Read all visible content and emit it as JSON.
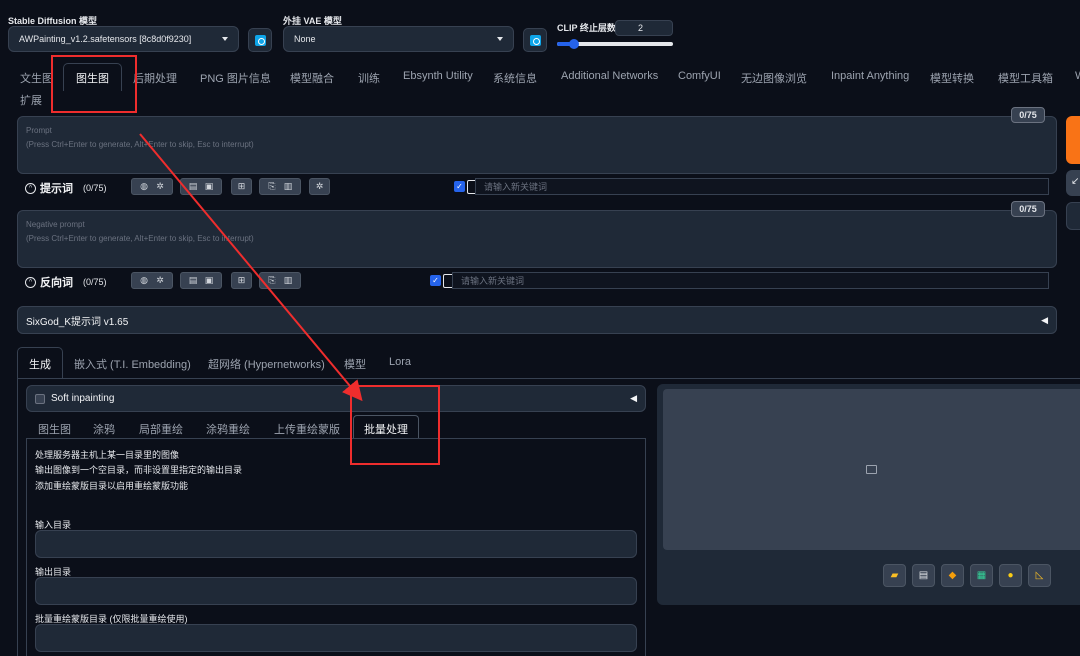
{
  "top": {
    "sd_model_label": "Stable Diffusion 模型",
    "sd_model_value": "AWPainting_v1.2.safetensors [8c8d0f9230]",
    "vae_label": "外挂 VAE 模型",
    "vae_value": "None",
    "clip_label": "CLIP 终止层数",
    "clip_value": "2"
  },
  "main_tabs": [
    "文生图",
    "图生图",
    "后期处理",
    "PNG 图片信息",
    "模型融合",
    "训练",
    "Ebsynth Utility",
    "系统信息",
    "Additional Networks",
    "ComfyUI",
    "无边图像浏览",
    "Inpaint Anything",
    "模型转换",
    "模型工具箱",
    "W"
  ],
  "main_tabs_row2": "扩展",
  "prompt": {
    "placeholder_line1": "Prompt",
    "placeholder_line2": "(Press Ctrl+Enter to generate, Alt+Enter to skip, Esc to interrupt)",
    "counter": "0/75",
    "toolbar_label": "提示词",
    "toolbar_count": "(0/75)",
    "keyword_placeholder": "请输入新关键词"
  },
  "negative": {
    "placeholder_line1": "Negative prompt",
    "placeholder_line2": "(Press Ctrl+Enter to generate, Alt+Enter to skip, Esc to interrupt)",
    "counter": "0/75",
    "toolbar_label": "反向词",
    "toolbar_count": "(0/75)",
    "keyword_placeholder": "请输入新关键词"
  },
  "sixgod": {
    "label": "SixGod_K提示词 v1.65"
  },
  "sub_tabs": [
    "生成",
    "嵌入式 (T.I. Embedding)",
    "超网络 (Hypernetworks)",
    "模型",
    "Lora"
  ],
  "soft_inpainting": {
    "label": "Soft inpainting"
  },
  "img2img_tabs": [
    "图生图",
    "涂鸦",
    "局部重绘",
    "涂鸦重绘",
    "上传重绘蒙版",
    "批量处理"
  ],
  "batch": {
    "desc1": "处理服务器主机上某一目录里的图像",
    "desc2": "输出图像到一个空目录，而非设置里指定的输出目录",
    "desc3": "添加重绘蒙版目录以启用重绘蒙版功能",
    "input_dir_label": "输入目录",
    "output_dir_label": "输出目录",
    "mask_dir_label": "批量重绘蒙版目录 (仅限批量重绘使用)"
  },
  "icons": [
    "refresh-icon",
    "caret-down-icon",
    "collapse-icon",
    "image-placeholder-icon",
    "folder-icon",
    "save-icon",
    "zip-icon",
    "send-to-img2img-icon",
    "palette-icon",
    "ruler-icon"
  ],
  "colors": {
    "bg": "#0b0f19",
    "panel": "#1f2937",
    "accent_orange": "#f97316",
    "annotation_red": "#ef2d2d",
    "check_blue": "#2563eb"
  }
}
